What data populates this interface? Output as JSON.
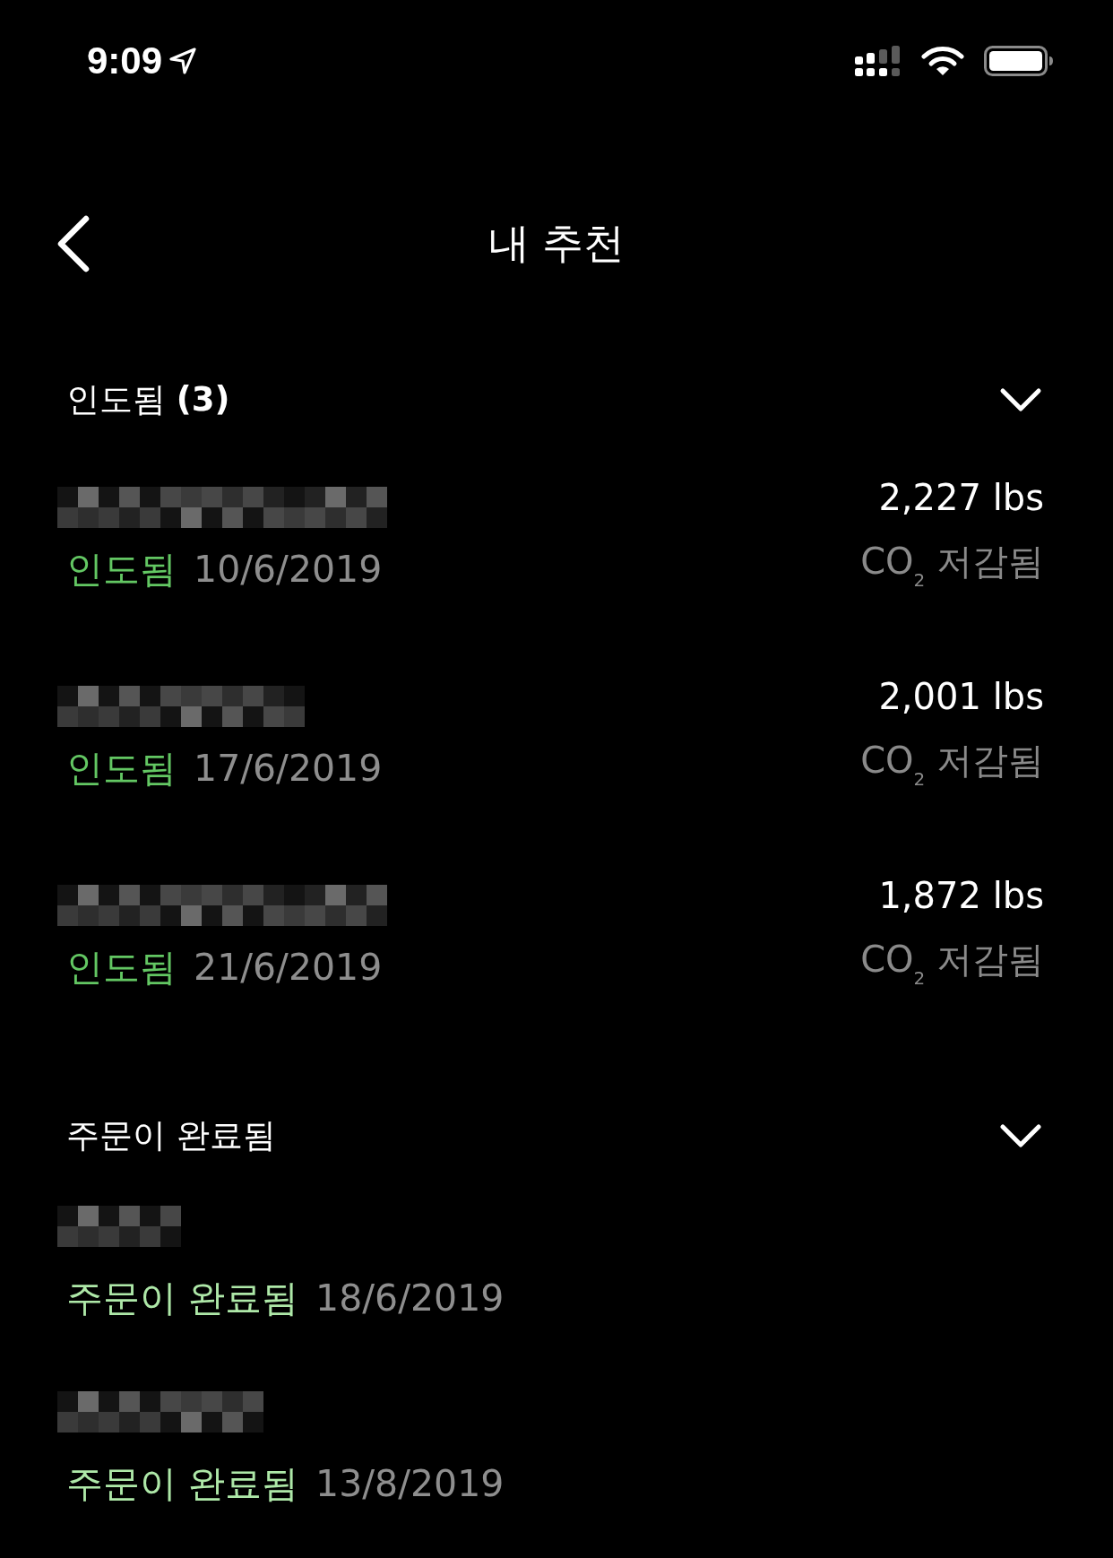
{
  "status_bar": {
    "time": "9:09"
  },
  "header": {
    "title": "내 추천"
  },
  "sections": [
    {
      "title": "인도됨 **(3)**",
      "expanded": true,
      "items": [
        {
          "status": "인도됨",
          "color": "#63c763",
          "date": "10/6/2019",
          "amount": "2,227 lbs",
          "amount_label": "CO$_{2}$ 저감됨"
        },
        {
          "status": "인도됨",
          "color": "#63c763",
          "date": "17/6/2019",
          "amount": "2,001 lbs",
          "amount_label": "CO$_{2}$ 저감됨"
        },
        {
          "status": "인도됨",
          "color": "#63c763",
          "date": "21/6/2019",
          "amount": "1,872 lbs",
          "amount_label": "CO$_{2}$ 저감됨"
        }
      ]
    },
    {
      "title": "주문이 완료됨",
      "expanded": true,
      "items": [
        {
          "status": "주문이 완료됨",
          "color": "#aee8a8",
          "date": "18/6/2019"
        },
        {
          "status": "주문이 완료됨",
          "color": "#aee8a8",
          "date": "13/8/2019"
        }
      ]
    }
  ]
}
